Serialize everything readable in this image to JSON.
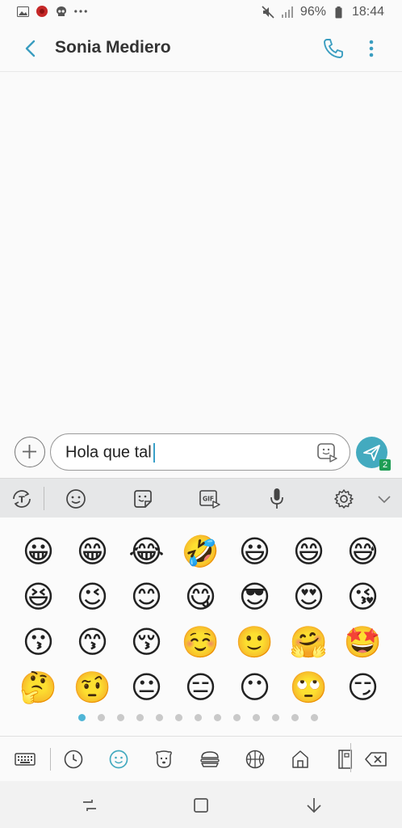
{
  "status_bar": {
    "battery_percent": "96%",
    "time": "18:44",
    "left_icons": [
      "gallery-icon",
      "app-red-icon",
      "skull-icon",
      "more-dots-icon"
    ],
    "right_icons": [
      "mute-icon",
      "signal-icon",
      "battery-icon"
    ]
  },
  "header": {
    "contact_name": "Sonia Mediero",
    "icons": [
      "back-icon",
      "phone-icon",
      "more-vertical-icon"
    ]
  },
  "composer": {
    "message_text": "Hola que tal",
    "send_badge": "2"
  },
  "keyboard_toolbar": {
    "items": [
      "text-translate-icon",
      "emoji-icon",
      "sticker-icon",
      "gif-icon",
      "microphone-icon",
      "settings-icon",
      "chevron-down-icon"
    ]
  },
  "emoji_panel": {
    "emojis": [
      "😀",
      "😁",
      "😂",
      "🤣",
      "😃",
      "😄",
      "😅",
      "😆",
      "😉",
      "😊",
      "😋",
      "😎",
      "😍",
      "😘",
      "😗",
      "😙",
      "😚",
      "☺️",
      "🙂",
      "🤗",
      "🤩",
      "🤔",
      "🤨",
      "😐",
      "😑",
      "😶",
      "🙄",
      "😏"
    ],
    "page_count": 13,
    "active_page": 1
  },
  "emoji_categories": {
    "items": [
      "keyboard-icon",
      "recent-icon",
      "smiley-icon",
      "animal-icon",
      "food-icon",
      "sports-icon",
      "building-icon",
      "objects-icon",
      "backspace-icon"
    ],
    "active": "smiley-icon"
  },
  "nav_bar": {
    "items": [
      "recents-icon",
      "home-icon",
      "back-nav-icon"
    ]
  },
  "colors": {
    "accent": "#43aabf",
    "active_dot": "#4fb5d6",
    "toolbar_bg": "#e6e7e8",
    "badge": "#1f9d55"
  }
}
